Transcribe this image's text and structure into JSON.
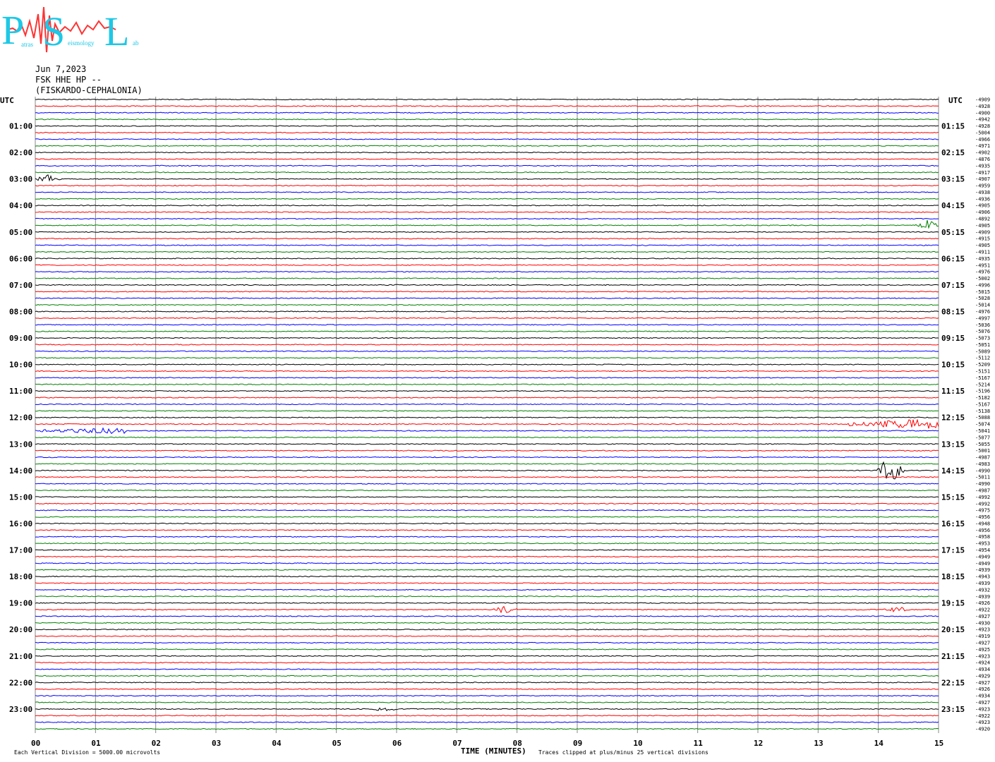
{
  "logo": {
    "letters": [
      "P",
      "S",
      "L"
    ],
    "words": [
      "atras",
      "eismology",
      "ab"
    ]
  },
  "header": {
    "date": "Jun 7,2023",
    "station": "FSK HHE HP --",
    "location": "(FISKARDO-CEPHALONIA)"
  },
  "utc_left": "UTC",
  "utc_right": "UTC",
  "hour_labels_left": [
    "01:00",
    "02:00",
    "03:00",
    "04:00",
    "05:00",
    "06:00",
    "07:00",
    "08:00",
    "09:00",
    "10:00",
    "11:00",
    "12:00",
    "13:00",
    "14:00",
    "15:00",
    "16:00",
    "17:00",
    "18:00",
    "19:00",
    "20:00",
    "21:00",
    "22:00",
    "23:00"
  ],
  "hour_labels_right": [
    "01:15",
    "02:15",
    "03:15",
    "04:15",
    "05:15",
    "06:15",
    "07:15",
    "08:15",
    "09:15",
    "10:15",
    "11:15",
    "12:15",
    "13:15",
    "14:15",
    "15:15",
    "16:15",
    "17:15",
    "18:15",
    "19:15",
    "20:15",
    "21:15",
    "22:15",
    "23:15"
  ],
  "x_tick_labels": [
    "00",
    "01",
    "02",
    "03",
    "04",
    "05",
    "06",
    "07",
    "08",
    "09",
    "10",
    "11",
    "12",
    "13",
    "14",
    "15"
  ],
  "offsets": [
    "-4909",
    "-4928",
    "-4900",
    "-4942",
    "-4928",
    "-5004",
    "-4966",
    "-4971",
    "-4902",
    "-4876",
    "-4935",
    "-4917",
    "-4907",
    "-4959",
    "-4938",
    "-4936",
    "-4905",
    "-4906",
    "-4892",
    "-4905",
    "-4909",
    "-4915",
    "-4905",
    "-4911",
    "-4935",
    "-4951",
    "-4976",
    "-5002",
    "-4996",
    "-5015",
    "-5028",
    "-5014",
    "-4976",
    "-4997",
    "-5036",
    "-5076",
    "-5073",
    "-5051",
    "-5089",
    "-5112",
    "-5209",
    "-5151",
    "-5167",
    "-5214",
    "-5196",
    "-5182",
    "-5167",
    "-5138",
    "-5088",
    "-5074",
    "-5041",
    "-5077",
    "-5055",
    "-5001",
    "-4987",
    "-4983",
    "-4990",
    "-5011",
    "-4990",
    "-4987",
    "-4992",
    "-4992",
    "-4975",
    "-4956",
    "-4948",
    "-4956",
    "-4958",
    "-4953",
    "-4954",
    "-4949",
    "-4949",
    "-4939",
    "-4943",
    "-4939",
    "-4932",
    "-4939",
    "-4926",
    "-4922",
    "-4927",
    "-4930",
    "-4923",
    "-4919",
    "-4927",
    "-4925",
    "-4923",
    "-4924",
    "-4934",
    "-4929",
    "-4927",
    "-4926",
    "-4934",
    "-4927",
    "-4923",
    "-4922",
    "-4923",
    "-4920"
  ],
  "footer": {
    "division": "Each Vertical Division = 5000.00 microvolts",
    "xlabel": "TIME (MINUTES)",
    "clip": "Traces clipped at plus/minus 25 vertical divisions"
  },
  "chart_data": {
    "type": "line",
    "title": "",
    "xlabel": "TIME (MINUTES)",
    "ylabel": "",
    "xlim": [
      0,
      15
    ],
    "traces_per_hour": 4,
    "trace_count": 96,
    "colors": [
      "#000000",
      "#ff0000",
      "#0000ff",
      "#008000"
    ],
    "events": [
      {
        "trace": 12,
        "minute": 0.2,
        "amplitude": 6,
        "color": "#000000"
      },
      {
        "trace": 19,
        "minute": 14.8,
        "amplitude": 8,
        "color": "#0000ff"
      },
      {
        "trace": 49,
        "minute_start": 13.5,
        "minute_end": 15,
        "amplitude": 8,
        "color": "#ff0000"
      },
      {
        "trace": 50,
        "minute_start": 0,
        "minute_end": 1.5,
        "amplitude": 4,
        "color": "#0000ff"
      },
      {
        "trace": 56,
        "minute": 14.2,
        "amplitude": 22,
        "color": "#000000"
      },
      {
        "trace": 77,
        "minute": 7.8,
        "amplitude": 5,
        "color": "#ff0000"
      },
      {
        "trace": 77,
        "minute": 14.3,
        "amplitude": 5,
        "color": "#ff0000"
      },
      {
        "trace": 92,
        "minute": 5.8,
        "amplitude": 3,
        "color": "#000000"
      }
    ]
  }
}
